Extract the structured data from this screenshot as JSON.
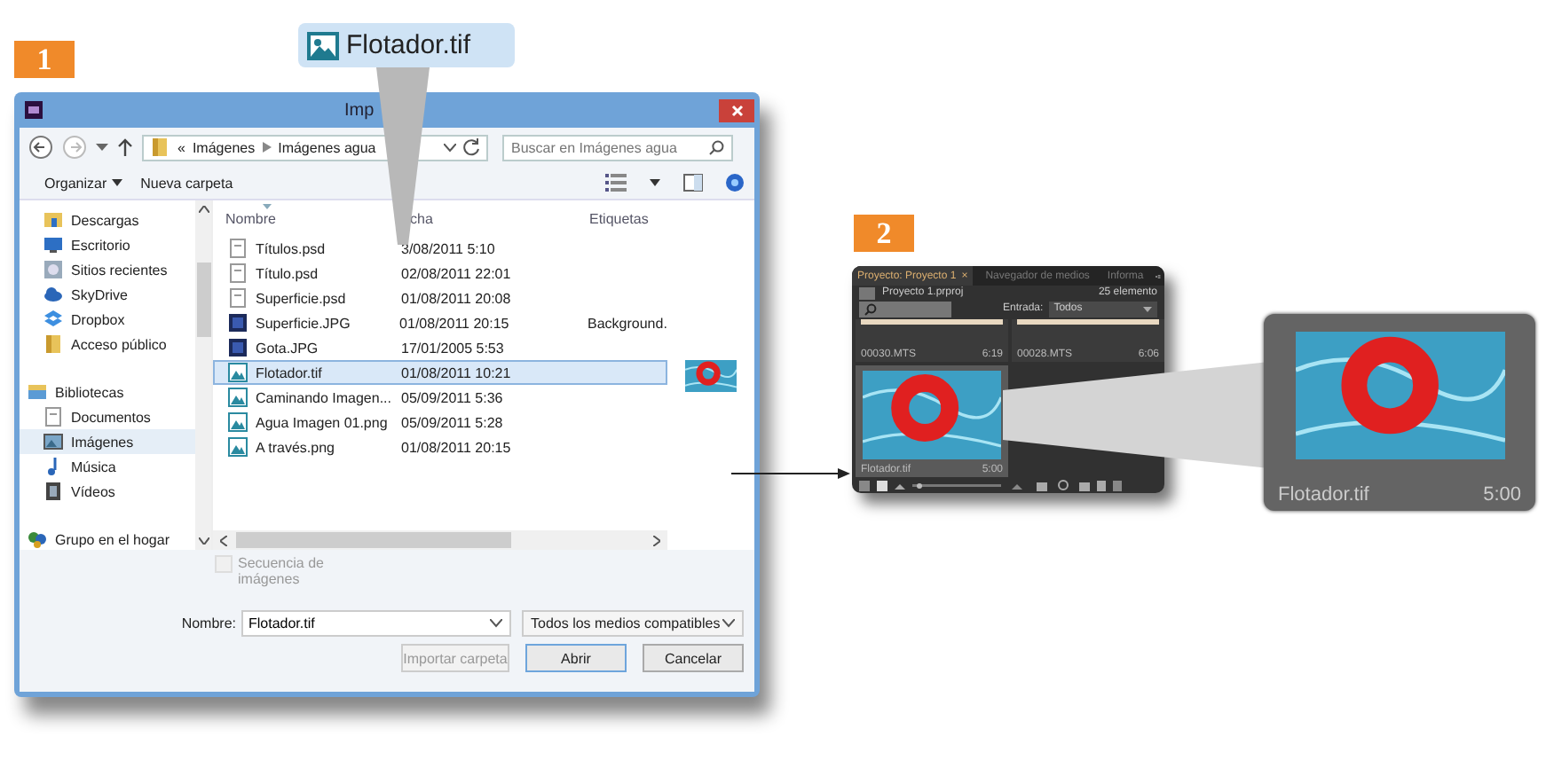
{
  "callout": {
    "label": "Flotador.tif"
  },
  "steps": [
    {
      "number": "1"
    },
    {
      "number": "2"
    }
  ],
  "dialog": {
    "title": "Imp",
    "address": {
      "prefix": "«",
      "crumbs": [
        "Imágenes",
        "Imágenes agua"
      ]
    },
    "search": {
      "placeholder": "Buscar en Imágenes agua"
    },
    "toolbar": [
      {
        "label": "Organizar",
        "menu": true
      },
      {
        "label": "Nueva carpeta",
        "menu": false
      }
    ],
    "nav": [
      {
        "children": [
          {
            "label": "Descargas",
            "kind": "download",
            "selected": false
          },
          {
            "label": "Escritorio",
            "kind": "desktop",
            "selected": false
          },
          {
            "label": "Sitios recientes",
            "kind": "recent",
            "selected": false
          },
          {
            "label": "SkyDrive",
            "kind": "cloud",
            "selected": false
          },
          {
            "label": "Dropbox",
            "kind": "box",
            "selected": false
          },
          {
            "label": "Acceso público",
            "kind": "folder",
            "selected": false
          }
        ]
      },
      {
        "label": "Bibliotecas",
        "kind": "library",
        "selected": false,
        "children": [
          {
            "label": "Documentos",
            "kind": "doc",
            "selected": false
          },
          {
            "label": "Imágenes",
            "kind": "pictures",
            "selected": true
          },
          {
            "label": "Música",
            "kind": "music",
            "selected": false
          },
          {
            "label": "Vídeos",
            "kind": "video",
            "selected": false
          }
        ]
      },
      {
        "label": "Grupo en el hogar",
        "kind": "homegroup",
        "selected": false
      }
    ],
    "columns": [
      "Nombre",
      "cha",
      "Etiquetas"
    ],
    "files": [
      {
        "name": "Títulos.psd",
        "date": "3/08/2011 5:10",
        "kind": "doc",
        "selected": false
      },
      {
        "name": "Título.psd",
        "date": "02/08/2011 22:01",
        "kind": "doc",
        "selected": false
      },
      {
        "name": "Superficie.psd",
        "date": "01/08/2011 20:08",
        "kind": "doc",
        "selected": false
      },
      {
        "name": "Superficie.JPG",
        "date": "01/08/2011 20:15",
        "tags": "Background.",
        "kind": "ps",
        "selected": false
      },
      {
        "name": "Gota.JPG",
        "date": "17/01/2005 5:53",
        "kind": "ps",
        "selected": false
      },
      {
        "name": "Flotador.tif",
        "date": "01/08/2011 10:21",
        "kind": "image",
        "selected": true
      },
      {
        "name": "Caminando Imagen...",
        "date": "05/09/2011 5:36",
        "kind": "image",
        "selected": false
      },
      {
        "name": "Agua Imagen 01.png",
        "date": "05/09/2011 5:28",
        "kind": "image",
        "selected": false
      },
      {
        "name": "A través.png",
        "date": "01/08/2011 20:15",
        "kind": "image",
        "selected": false
      }
    ],
    "sequence": {
      "label": "Secuencia de imágenes",
      "checked": false,
      "disabled": true
    },
    "name_label": "Nombre:",
    "name_value": "Flotador.tif",
    "filter": "Todos los medios compatibles",
    "buttons": [
      {
        "label": "Importar carpeta",
        "disabled": true,
        "default": false
      },
      {
        "label": "Abrir",
        "disabled": false,
        "default": true
      },
      {
        "label": "Cancelar",
        "disabled": false,
        "default": false
      }
    ]
  },
  "project": {
    "tabs": [
      {
        "label": "Proyecto: Proyecto 1",
        "close": "×",
        "selected": true
      },
      {
        "label": "Navegador de medios",
        "selected": false
      },
      {
        "label": "Informa",
        "selected": false
      }
    ],
    "file": "Proyecto 1.prproj",
    "count": "25 elemento",
    "filter_label": "Entrada:",
    "filter_value": "Todos",
    "clips": [
      {
        "name": "00030.MTS",
        "duration": "6:19",
        "selected": false,
        "kind": "strip"
      },
      {
        "name": "00028.MTS",
        "duration": "6:06",
        "selected": false,
        "kind": "strip"
      },
      {
        "name": "Flotador.tif",
        "duration": "5:00",
        "selected": true,
        "kind": "photo"
      }
    ]
  },
  "zoom": {
    "name": "Flotador.tif",
    "duration": "5:00"
  }
}
